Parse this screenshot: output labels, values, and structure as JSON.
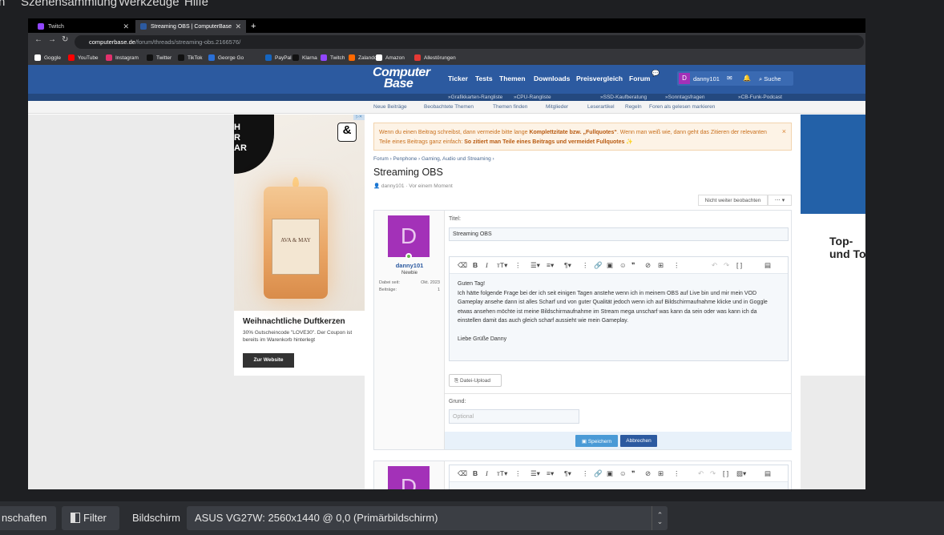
{
  "menubar": {
    "items": [
      "n",
      "Szenensammlung",
      "Werkzeuge",
      "Hilfe"
    ]
  },
  "browser": {
    "tabs": [
      {
        "label": "Twitch",
        "active": false
      },
      {
        "label": "Streaming OBS | ComputerBase",
        "active": true
      }
    ],
    "new_tab": "+",
    "url_domain": "computerbase.de",
    "url_path": "/forum/threads/streaming-obs.2166576/",
    "bookmarks": [
      {
        "label": "Goggle",
        "color": "#ffffff"
      },
      {
        "label": "YouTube",
        "color": "#ff0000"
      },
      {
        "label": "Instagram",
        "color": "#e1306c"
      },
      {
        "label": "Twitter",
        "color": "#111111"
      },
      {
        "label": "TikTok",
        "color": "#111111"
      },
      {
        "label": "George Go",
        "color": "#2a6fd6"
      },
      {
        "label": "PayPal",
        "color": "#1565c0"
      },
      {
        "label": "Klarna",
        "color": "#111111"
      },
      {
        "label": "Twitch",
        "color": "#9146ff"
      },
      {
        "label": "Zalando",
        "color": "#ff6900"
      },
      {
        "label": "Amazon",
        "color": "#ffffff"
      },
      {
        "label": "Allestörungen",
        "color": "#e53935"
      }
    ]
  },
  "site": {
    "logo_line1": "Computer",
    "logo_line2": "Base",
    "nav": [
      "Ticker",
      "Tests",
      "Themen",
      "Downloads",
      "Preisvergleich",
      "Forum"
    ],
    "username": "danny101",
    "user_initial": "D",
    "search_label": "Suche",
    "subnav": [
      "»Grafikkarten-Rangliste",
      "»CPU-Rangliste",
      "»SSD-Kaufberatung",
      "»Sonntagsfragen",
      "»CB-Funk-Podcast"
    ],
    "subnav2": [
      "Neue Beiträge",
      "Beobachtete Themen",
      "Themen finden",
      "Mitglieder",
      "Leserartikel",
      "Regeln",
      "Foren als gelesen markieren"
    ]
  },
  "ad": {
    "corner_text": "H\nR\nAR",
    "badge": "&",
    "label_brand": "AVA & MAY",
    "title": "Weihnachtliche Duftkerzen",
    "desc": "30% Gutscheincode \"LOVE30\". Der Coupon ist bereits im Warenkorb hinterlegt",
    "button": "Zur Website"
  },
  "right_ad": {
    "text": "Top-\nund To"
  },
  "thread": {
    "notice_pre": "Wenn du einen Beitrag schreibst, dann vermeide bitte lange ",
    "notice_bold1": "Komplettzitate bzw. „Fullquotes“",
    "notice_mid": ". Wenn man weiß wie, dann geht das Zitieren der relevanten Teile eines Beitrags ganz einfach: ",
    "notice_bold2": "So zitiert man Teile eines Beitrags und vermeidet Fullquotes ✨",
    "notice_close": "×",
    "breadcrumb": "Forum  ›  Penphone  ›  Gaming, Audio und Streaming  ›",
    "title": "Streaming OBS",
    "meta": "danny101 · Vor einem Moment",
    "watch_button": "Nicht weiter beobachten",
    "more_button": "⋯ ▾"
  },
  "post": {
    "avatar_letter": "D",
    "username": "danny101",
    "rank": "Newbie",
    "stats": [
      {
        "label": "Dabei seit:",
        "value": "Okt. 2023"
      },
      {
        "label": "Beiträge:",
        "value": "1"
      }
    ],
    "title_label": "Titel:",
    "title_value": "Streaming OBS",
    "body": "Guten Tag!\nIch hätte folgende Frage bei der ich seit einigen Tagen anstehe wenn ich in meinem OBS auf Live bin und mir mein VOD Gameplay ansehe dann ist alles Scharf und von guter Qualität jedoch wenn ich auf Bildschirmaufnahme klicke und in Goggle etwas ansehen möchte ist meine Bildschirmaufnahme im Stream mega unscharf was kann da sein oder was kann ich da einstellen damit das auch gleich scharf aussieht wie mein Gameplay.\n\nLiebe Grüße Danny",
    "upload_label": "Datei-Upload",
    "reason_label": "Grund:",
    "reason_placeholder": "Optional",
    "save_button": "Speichern",
    "cancel_button": "Abbrechen"
  },
  "obs_bottom": {
    "properties_button": "nschaften",
    "filter_button": "Filter",
    "display_label": "Bildschirm",
    "display_value": "ASUS VG27W: 2560x1440 @ 0,0 (Primärbildschirm)"
  }
}
